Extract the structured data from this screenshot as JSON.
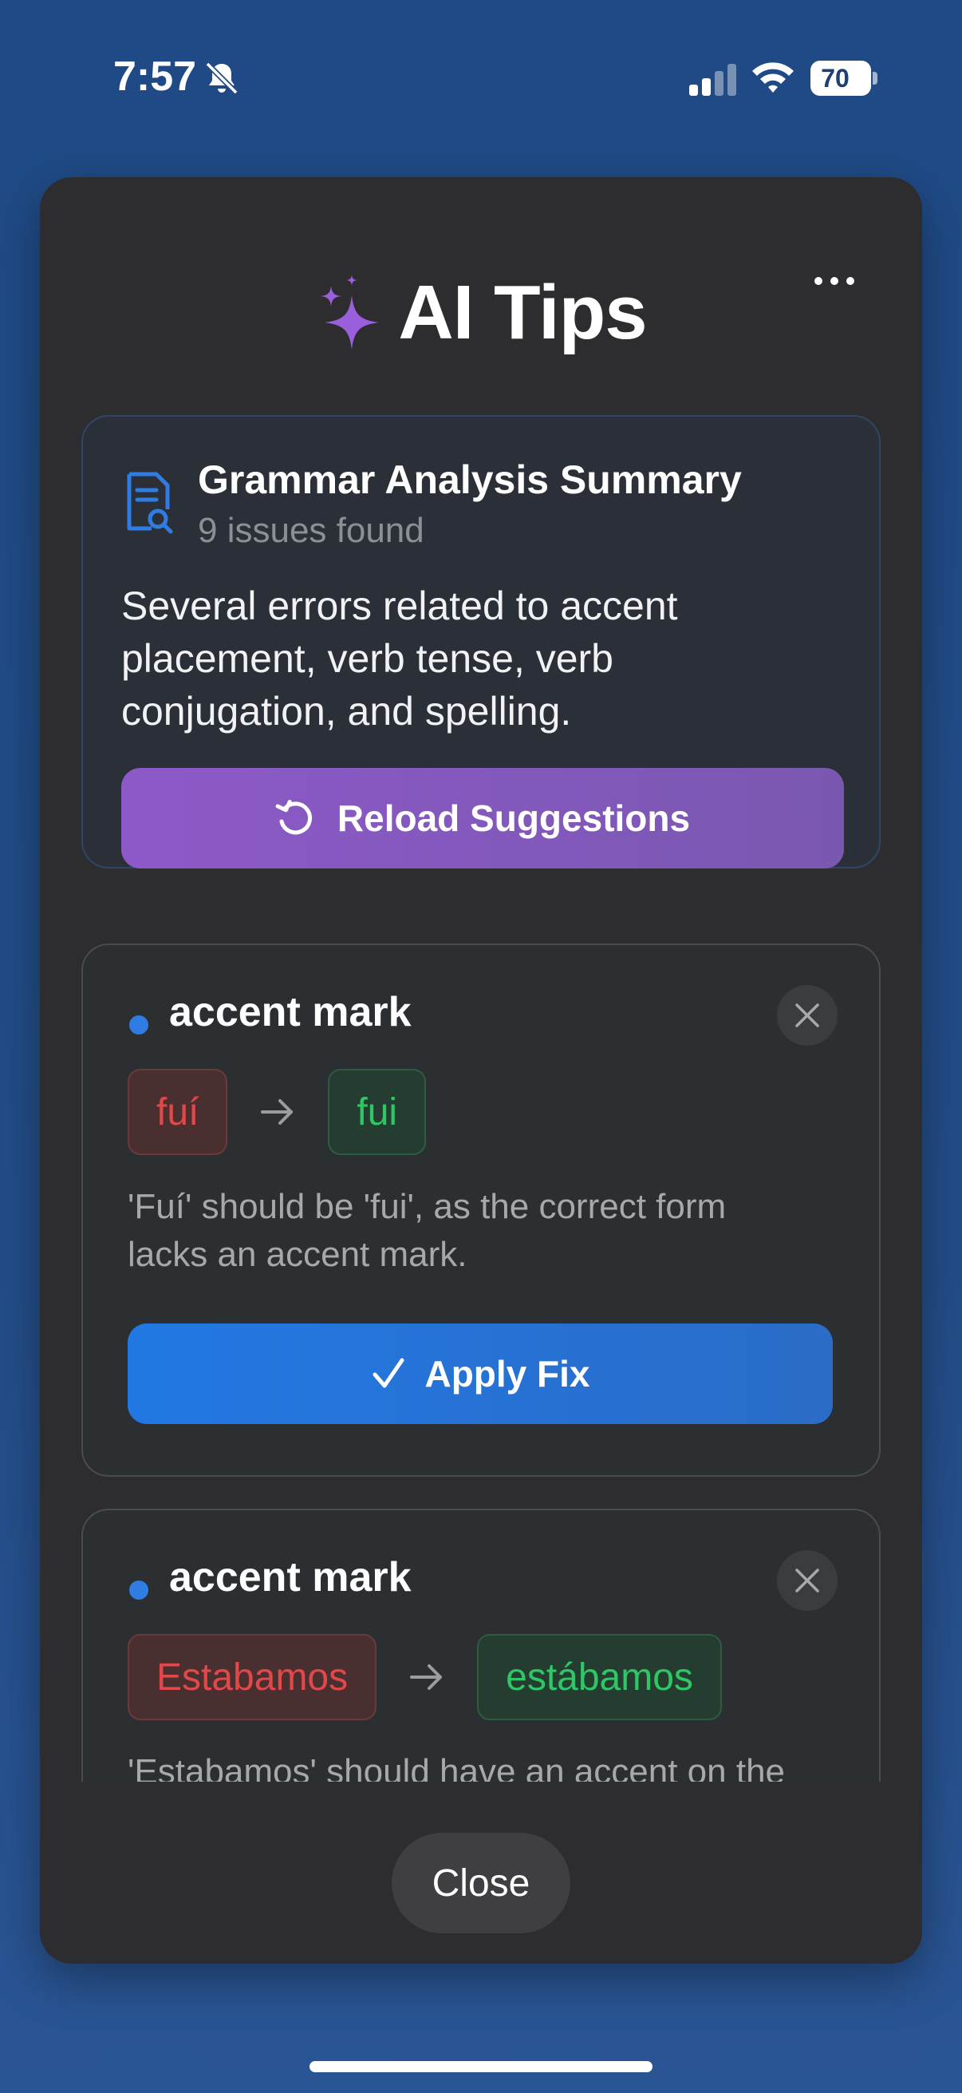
{
  "status": {
    "time": "7:57",
    "battery": "70",
    "signal_bars_lit": 2,
    "signal_bars_total": 4
  },
  "sheet": {
    "title": "AI Tips",
    "more_icon": "ellipsis-icon",
    "title_icon": "sparkle-icon"
  },
  "summary": {
    "title": "Grammar Analysis Summary",
    "count": "9 issues found",
    "description": "Several errors related to accent placement, verb tense, verb conjugation, and spelling.",
    "reload_label": "Reload Suggestions",
    "icon": "document-search-icon",
    "accent": "#8d59c9"
  },
  "suggestions": [
    {
      "category": "accent mark",
      "original": "fuí",
      "corrected": "fui",
      "explanation": "'Fuí' should be 'fui', as the correct form lacks an accent mark.",
      "apply_label": "Apply Fix"
    },
    {
      "category": "accent mark",
      "original": "Estabamos",
      "corrected": "estábamos",
      "explanation": "'Estabamos' should have an accent on the"
    }
  ],
  "colors": {
    "wrong": "#e0484a",
    "right": "#2fc766",
    "primary": "#2278e3"
  },
  "footer": {
    "close_label": "Close"
  }
}
